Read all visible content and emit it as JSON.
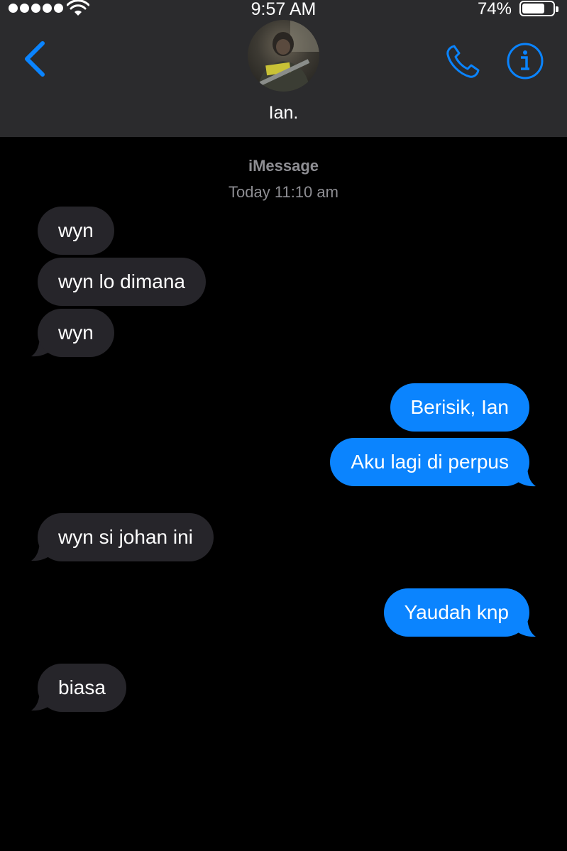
{
  "status_bar": {
    "time": "9:57 AM",
    "battery_percent": "74%",
    "battery_level": 0.74,
    "signal_bars": 5
  },
  "header": {
    "contact_name": "Ian.",
    "icons": [
      "back-chevron-icon",
      "contact-avatar",
      "phone-icon",
      "info-icon"
    ]
  },
  "thread": {
    "service": "iMessage",
    "timestamp": "Today 11:10 am"
  },
  "messages": [
    {
      "direction": "incoming",
      "text": "wyn"
    },
    {
      "direction": "incoming",
      "text": "wyn lo dimana"
    },
    {
      "direction": "incoming",
      "text": "wyn"
    },
    {
      "direction": "outgoing",
      "text": "Berisik, Ian"
    },
    {
      "direction": "outgoing",
      "text": "Aku lagi di perpus"
    },
    {
      "direction": "incoming",
      "text": "wyn si johan ini"
    },
    {
      "direction": "outgoing",
      "text": "Yaudah knp"
    },
    {
      "direction": "incoming",
      "text": "biasa"
    }
  ],
  "colors": {
    "accent": "#0a84ff",
    "incoming_bubble": "#26252a",
    "outgoing_bubble": "#0b84fe",
    "header_bg": "#2b2b2d",
    "background": "#000000",
    "meta_text": "#8e8e93"
  }
}
